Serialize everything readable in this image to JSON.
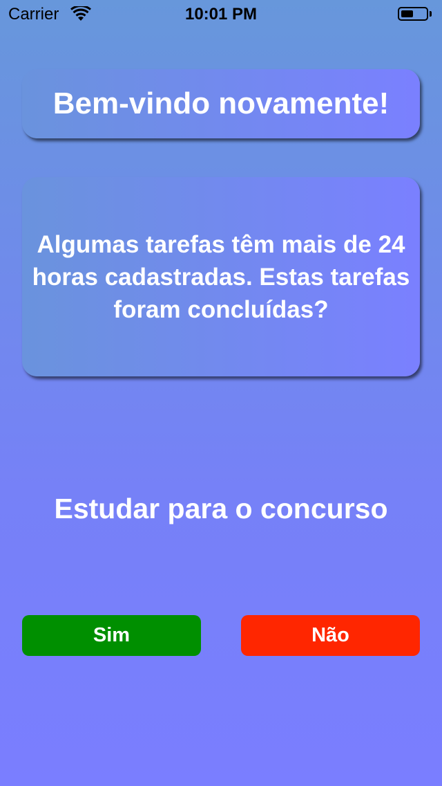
{
  "status_bar": {
    "carrier": "Carrier",
    "time": "10:01 PM",
    "wifi_icon": "wifi-icon",
    "battery_icon": "battery-icon",
    "battery_level": 0.5
  },
  "welcome": {
    "title": "Bem-vindo novamente!"
  },
  "question": {
    "text": "Algumas tarefas têm mais de 24 horas cadastradas. Estas tarefas foram concluídas?"
  },
  "task": {
    "name": "Estudar para o concurso"
  },
  "actions": {
    "yes_label": "Sim",
    "no_label": "Não"
  },
  "colors": {
    "background_top": "#6797DB",
    "background_bottom": "#7A7EFF",
    "yes_button": "#008F00",
    "no_button": "#FF2600",
    "text": "#FFFFFF"
  }
}
